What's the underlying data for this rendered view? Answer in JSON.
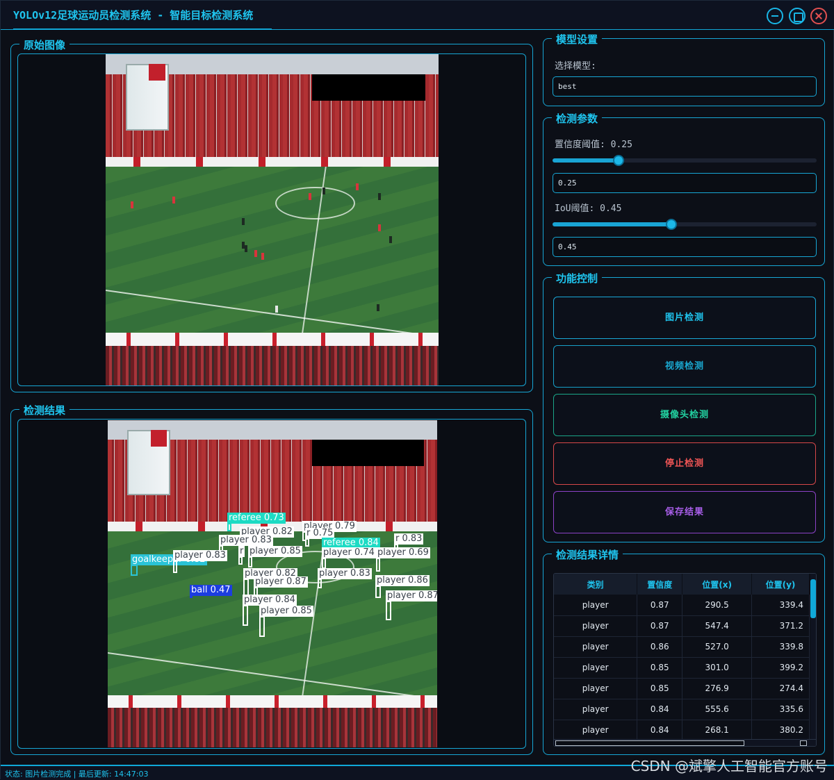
{
  "window": {
    "title": "YOLOv12足球运动员检测系统 - 智能目标检测系统"
  },
  "panels": {
    "original_title": "原始图像",
    "result_title": "检测结果"
  },
  "model_settings": {
    "title": "模型设置",
    "select_label": "选择模型:",
    "selected_model": "best"
  },
  "detection_params": {
    "title": "检测参数",
    "conf_label": "置信度阈值: 0.25",
    "conf_value": "0.25",
    "conf_fraction": 0.25,
    "iou_label": "IoU阈值: 0.45",
    "iou_value": "0.45",
    "iou_fraction": 0.45
  },
  "controls": {
    "title": "功能控制",
    "image_detect": "图片检测",
    "video_detect": "视频检测",
    "camera_detect": "摄像头检测",
    "stop_detect": "停止检测",
    "save_results": "保存结果"
  },
  "results": {
    "title": "检测结果详情",
    "columns": [
      "类别",
      "置信度",
      "位置(x)",
      "位置(y)"
    ],
    "rows": [
      [
        "player",
        "0.87",
        "290.5",
        "339.4"
      ],
      [
        "player",
        "0.87",
        "547.4",
        "371.2"
      ],
      [
        "player",
        "0.86",
        "527.0",
        "339.8"
      ],
      [
        "player",
        "0.85",
        "301.0",
        "399.2"
      ],
      [
        "player",
        "0.85",
        "276.9",
        "274.4"
      ],
      [
        "player",
        "0.84",
        "555.6",
        "335.6"
      ],
      [
        "player",
        "0.84",
        "268.1",
        "380.2"
      ]
    ]
  },
  "detections": [
    "referee 0.73",
    "player 0.79",
    "player 0.82",
    "r 0.75",
    "player 0.83",
    "referee 0.84",
    "r 0.83",
    "r",
    "player 0.85",
    "player 0.74",
    "player 0.69",
    "goalkeeper 0.82",
    "player 0.83",
    "player 0.82",
    "player 0.87",
    "player 0.83",
    "player 0.86",
    "ball 0.47",
    "player 0.87",
    "player 0.84",
    "player 0.85"
  ],
  "status": {
    "text": "状态: 图片检测完成 | 最后更新: 14:47:03"
  },
  "watermark": "CSDN @斌擎人工智能官方账号",
  "colors": {
    "accent": "#1fc4ee",
    "stop": "#ef5555",
    "camera": "#22d0a0",
    "save": "#a85ee8"
  }
}
